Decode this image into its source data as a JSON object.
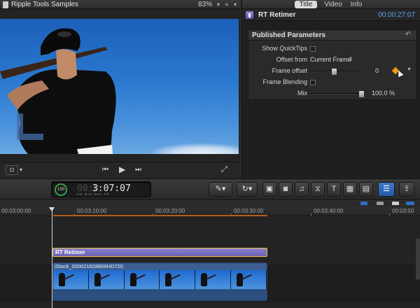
{
  "viewer": {
    "title": "Ripple Tools Samples",
    "zoom": "83%"
  },
  "inspector": {
    "tabs": [
      {
        "label": "Title",
        "active": true
      },
      {
        "label": "Video",
        "active": false
      },
      {
        "label": "Info",
        "active": false
      }
    ],
    "effect_name": "RT Retimer",
    "timecode": "00:00:27:07",
    "section_title": "Published Parameters",
    "params": {
      "show_quicktips": {
        "label": "Show QuickTips",
        "checked": false
      },
      "offset_from": {
        "label": "Offset from",
        "value": "Current Frame"
      },
      "frame_offset": {
        "label": "Frame offset",
        "value": "0",
        "slider": 0.5
      },
      "frame_blending": {
        "label": "Frame Blending",
        "checked": false
      },
      "mix": {
        "label": "Mix",
        "value": "100.0",
        "unit": "%",
        "slider": 1.0
      }
    }
  },
  "toolbar": {
    "timecode": "3:07:07",
    "timecode_dim": "00:0",
    "timecode_units": "HR  MIN  SEC  FR",
    "ring_label": "100",
    "title_tool": "T"
  },
  "timeline": {
    "ruler": [
      "00:03:00:00",
      "00:03:10:00",
      "00:03:20:00",
      "00:03:30:00",
      "00:03:40:00",
      "00:03:50"
    ],
    "effect_clip": "RT Retimer",
    "video_clip": "iStock_000021628806HD720"
  },
  "colors": {
    "accent_blue": "#5aa6f3",
    "effect_purple": "#7a70c4",
    "keyframe_orange": "#f2a11e",
    "range_orange": "#b85c1b",
    "clip_blue": "#3a5f93"
  }
}
